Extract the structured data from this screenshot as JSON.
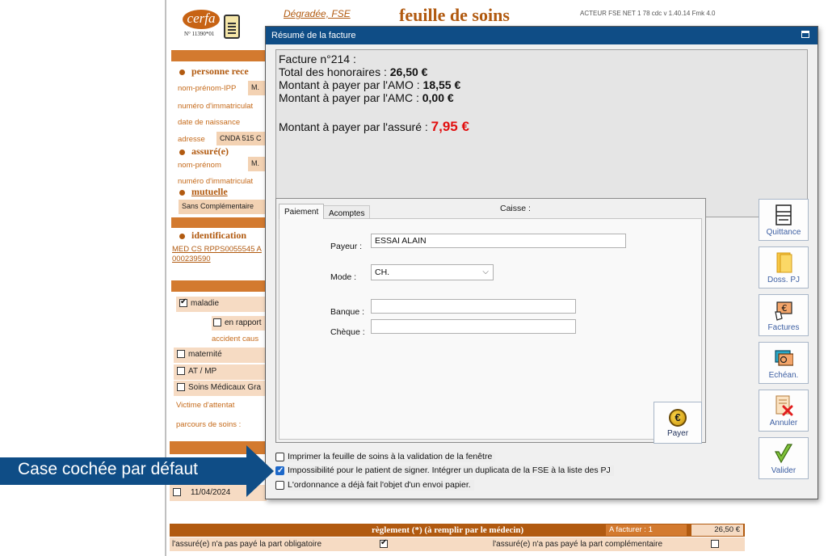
{
  "background_form": {
    "cerfa_logo": "cerfa",
    "cerfa_number": "N° 11390*01",
    "degradee_link": "Dégradée, FSE",
    "title": "feuille de soins",
    "acteur_version": "ACTEUR FSE NET 1 78  cdc v 1.40.14  Fmk 4.0",
    "section_personne": "personne rece",
    "label_nom_prenom_ipp": "nom-prénom-IPP",
    "value_nom_prenom_ipp": "M.",
    "label_num_immat": "numéro d'immatriculat",
    "label_date_naissance": "date de naissance",
    "label_adresse": "adresse",
    "value_adresse": "CNDA 515 C",
    "section_assure": "assuré(e)",
    "label_nom_prenom": "nom-prénom",
    "value_nom_prenom": "M.",
    "label_num_immat2": "numéro d'immatriculat",
    "section_mutuelle": "mutuelle",
    "value_mutuelle": "Sans Complémentaire",
    "section_identification": "identification",
    "med_link_1": "MED CS RPPS0055545 A",
    "med_link_2": "000239590",
    "chk_maladie": "maladie",
    "chk_en_rapport": "en rapport",
    "label_accident": "accident caus",
    "chk_maternite": "maternité",
    "chk_at_mp": "AT / MP",
    "chk_soins_medicaux": "Soins Médicaux Gra",
    "label_victime": "Victime d'attentat",
    "label_parcours": "parcours de soins :",
    "date_row": "11/04/2024",
    "reglement_title": "règlement (*) (à remplir par le médecin)",
    "a_facturer": "A facturer : 1",
    "a_facturer_amount": "26,50 €",
    "not_paid_mandatory": "l'assuré(e) n'a pas payé la part obligatoire",
    "not_paid_complementary": "l'assuré(e) n'a pas payé la part complémentaire"
  },
  "modal": {
    "title": "Résumé de la facture",
    "summary": {
      "invoice_line": "Facture n°214 :",
      "total_label": "Total des honoraires : ",
      "total_value": "26,50 €",
      "amo_label": "Montant à payer par l'AMO : ",
      "amo_value": "18,55 €",
      "amc_label": "Montant à payer par l'AMC : ",
      "amc_value": "0,00 €",
      "assure_label": "Montant à payer par l'assuré : ",
      "assure_value": "7,95 €"
    },
    "tabs": [
      {
        "label": "Paiement",
        "active": true
      },
      {
        "label": "Acomptes",
        "active": false
      }
    ],
    "caisse_label": "Caisse :",
    "payment": {
      "payeur_label": "Payeur :",
      "payeur_value": "ESSAI ALAIN",
      "mode_label": "Mode :",
      "mode_value": "CH.",
      "banque_label": "Banque :",
      "banque_value": "",
      "cheque_label": "Chèque :",
      "cheque_value": "",
      "payer_button": "Payer"
    },
    "options": [
      {
        "label": "Imprimer la feuille de soins à la validation de la fenêtre",
        "checked": false
      },
      {
        "label": "Impossibilité pour le patient de signer. Intégrer un duplicata de la FSE à la liste des PJ",
        "checked": true
      },
      {
        "label": "L'ordonnance a déjà fait l'objet d'un envoi papier.",
        "checked": false
      }
    ],
    "side_buttons": {
      "quittance": "Quittance",
      "doss_pj": "Doss. PJ",
      "factures": "Factures",
      "echean": "Echéan.",
      "annuler": "Annuler",
      "valider": "Valider"
    }
  },
  "callout": "Case cochée par défaut",
  "colors": {
    "titlebar": "#0f4d86",
    "accent_orange": "#d37a2f",
    "amount_red": "#e20f0f"
  }
}
